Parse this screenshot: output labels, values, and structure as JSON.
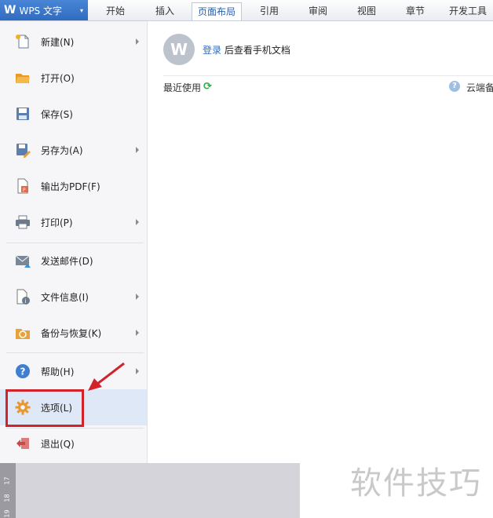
{
  "app": {
    "logo": "W",
    "title": "WPS 文字",
    "dropdown_glyph": "▾"
  },
  "tabs": [
    {
      "label": "开始"
    },
    {
      "label": "插入"
    },
    {
      "label": "页面布局",
      "active": true
    },
    {
      "label": "引用"
    },
    {
      "label": "审阅"
    },
    {
      "label": "视图"
    },
    {
      "label": "章节"
    },
    {
      "label": "开发工具"
    }
  ],
  "menu": {
    "items": [
      {
        "label": "新建(N)",
        "icon": "new-document-icon",
        "submenu": true
      },
      {
        "label": "打开(O)",
        "icon": "open-folder-icon",
        "submenu": false
      },
      {
        "label": "保存(S)",
        "icon": "save-disk-icon",
        "submenu": false
      },
      {
        "label": "另存为(A)",
        "icon": "save-as-icon",
        "submenu": true
      },
      {
        "label": "输出为PDF(F)",
        "icon": "pdf-export-icon",
        "submenu": false
      },
      {
        "label": "打印(P)",
        "icon": "printer-icon",
        "submenu": true
      },
      {
        "label": "发送邮件(D)",
        "icon": "mail-icon",
        "submenu": false
      },
      {
        "label": "文件信息(I)",
        "icon": "file-info-icon",
        "submenu": true
      },
      {
        "label": "备份与恢复(K)",
        "icon": "backup-restore-icon",
        "submenu": true
      },
      {
        "label": "帮助(H)",
        "icon": "help-icon",
        "submenu": true
      },
      {
        "label": "选项(L)",
        "icon": "gear-icon",
        "submenu": false
      },
      {
        "label": "退出(Q)",
        "icon": "exit-icon",
        "submenu": false
      }
    ]
  },
  "recent": {
    "avatar_letter": "W",
    "login_link": "登录",
    "login_text": " 后查看手机文档",
    "recent_label": "最近使用",
    "cloud_label": "云端备",
    "help_glyph": "?"
  },
  "ruler_numbers": [
    "17",
    "18",
    "19"
  ],
  "watermark": "软件技巧",
  "colors": {
    "accent": "#2f6cc0",
    "annotation": "#d2232a",
    "highlight": "#dfe8f6"
  }
}
